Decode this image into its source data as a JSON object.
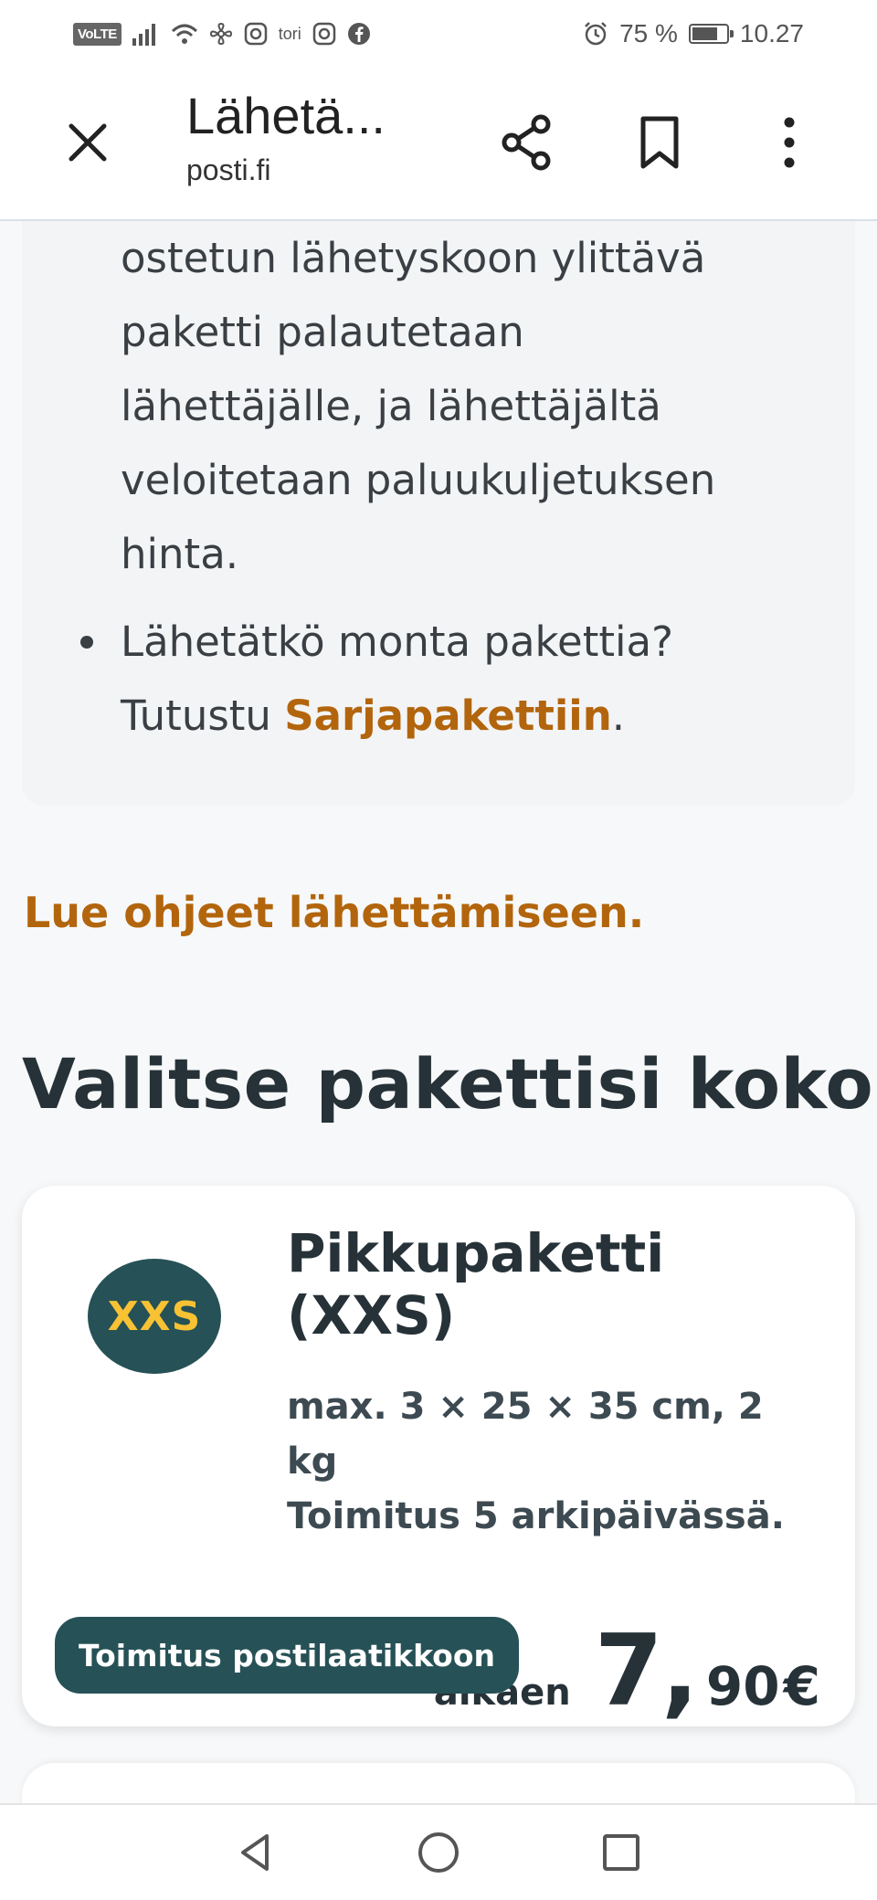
{
  "status_bar": {
    "volte": "VoLTE",
    "tori": "tori",
    "battery_percent_text": "75 %",
    "battery_level": 0.75,
    "time": "10.27"
  },
  "app_bar": {
    "title": "Lähetä...",
    "subtitle": "posti.fi"
  },
  "info": {
    "paragraph_lines": [
      "ostetun lähetyskoon ylittävä",
      "paketti palautetaan",
      "lähettäjälle, ja lähettäjältä",
      "veloitetaan paluukuljetuksen",
      "hinta."
    ],
    "bullet_line1": "Lähetätkö monta pakettia?",
    "bullet_line2_prefix": "Tutustu ",
    "bullet_link": "Sarjapakettiin",
    "bullet_line2_suffix": "."
  },
  "guide_link": "Lue ohjeet lähettämiseen.",
  "section_heading": "Valitse pakettisi koko",
  "package": {
    "badge": "XXS",
    "name_line1": "Pikkupaketti",
    "name_line2": "(XXS)",
    "dims_line1": "max. 3 × 25 × 35 cm, 2",
    "dims_line2": "kg",
    "delivery": "Toimitus 5 arkipäivässä.",
    "price_prefix": "alkaen",
    "price_euros": "7",
    "price_comma": ",",
    "price_cents": "90",
    "price_currency": "€",
    "tag": "Toimitus postilaatikkoon"
  },
  "icons": {
    "close": "close-icon",
    "share": "share-icon",
    "bookmark": "bookmark-icon",
    "more": "more-vertical-icon",
    "back": "nav-back-icon",
    "home": "nav-home-icon",
    "recents": "nav-recents-icon"
  },
  "colors": {
    "accent_link": "#b2650c",
    "badge_bg": "#265156",
    "badge_text": "#f8c233",
    "heading": "#263238"
  }
}
